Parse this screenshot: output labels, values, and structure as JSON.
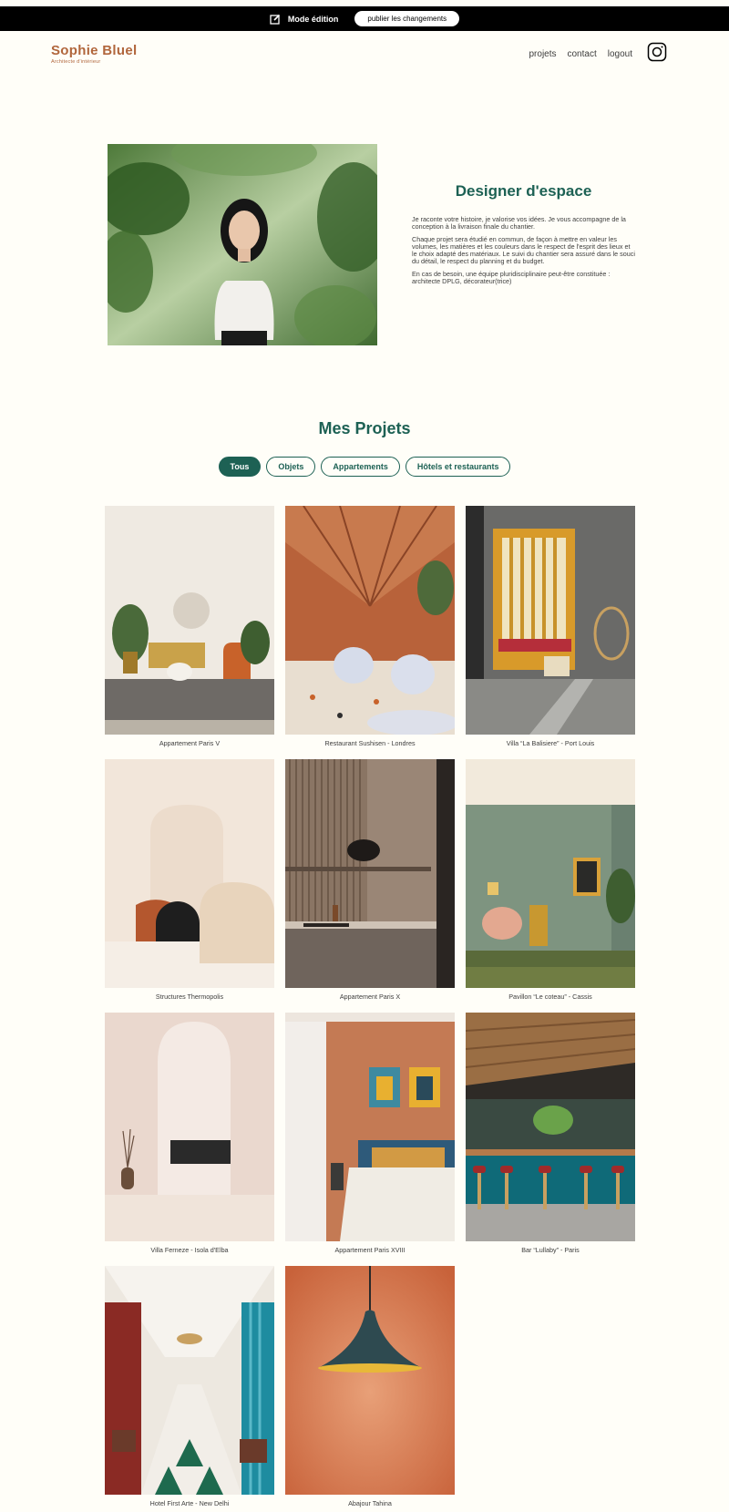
{
  "edit_bar": {
    "mode_label": "Mode édition",
    "publish_label": "publier les changements"
  },
  "header": {
    "logo_name": "Sophie Bluel",
    "logo_subtitle": "Architecte d'intérieur",
    "nav": [
      "projets",
      "contact",
      "logout"
    ],
    "social_icon": "instagram-icon"
  },
  "intro": {
    "title": "Designer d'espace",
    "paragraphs": [
      "Je raconte votre histoire, je valorise vos idées. Je vous accompagne de la conception à la livraison finale du chantier.",
      "Chaque projet sera étudié en commun, de façon à mettre en valeur les volumes, les matières et les couleurs dans le respect de l'esprit des lieux et le choix adapté des matériaux. Le suivi du chantier sera assuré dans le souci du détail, le respect du planning et du budget.",
      "En cas de besoin, une équipe pluridisciplinaire peut-être constituée : architecte DPLG, décorateur(trice)"
    ]
  },
  "projects": {
    "title": "Mes Projets",
    "filters": [
      "Tous",
      "Objets",
      "Appartements",
      "Hôtels et restaurants"
    ],
    "active_filter": "Tous",
    "items": [
      "Appartement Paris V",
      "Restaurant Sushisen - Londres",
      "Villa “La Balisiere” - Port Louis",
      "Structures Thermopolis",
      "Appartement Paris X",
      "Pavillon “Le coteau” - Cassis",
      "Villa Ferneze - Isola d'Elba",
      "Appartement Paris XVIII",
      "Bar “Lullaby” - Paris",
      "Hotel First Arte - New Delhi",
      "Abajour Tahina"
    ]
  },
  "colors": {
    "accent": "#1D6154",
    "brand": "#B1663C",
    "background": "#FFFEF8",
    "edit_bar": "#000000"
  }
}
